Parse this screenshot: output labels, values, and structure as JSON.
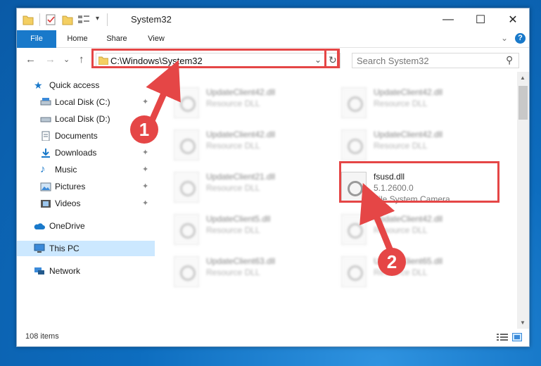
{
  "window": {
    "title": "System32",
    "qa_dropdown": "▾",
    "min": "—",
    "max": "☐",
    "close": "✕"
  },
  "ribbon": {
    "tabs": [
      "File",
      "Home",
      "Share",
      "View"
    ],
    "collapse": "⌄",
    "help": "?"
  },
  "nav": {
    "back": "←",
    "forward": "→",
    "recent": "⌄",
    "up": "↑",
    "address": "C:\\Windows\\System32",
    "address_dropdown": "⌄",
    "refresh": "↻",
    "search_placeholder": "Search System32",
    "search_icon": "⚲"
  },
  "sidebar": {
    "items": [
      {
        "label": "Quick access",
        "icon": "star-icon",
        "pinned": false
      },
      {
        "label": "Local Disk (C:)",
        "icon": "drive-icon",
        "pinned": true
      },
      {
        "label": "Local Disk (D:)",
        "icon": "drive-icon",
        "pinned": false
      },
      {
        "label": "Documents",
        "icon": "documents-icon",
        "pinned": true
      },
      {
        "label": "Downloads",
        "icon": "download-icon",
        "pinned": true
      },
      {
        "label": "Music",
        "icon": "music-icon",
        "pinned": true
      },
      {
        "label": "Pictures",
        "icon": "pictures-icon",
        "pinned": true
      },
      {
        "label": "Videos",
        "icon": "videos-icon",
        "pinned": true
      },
      {
        "label": "OneDrive",
        "icon": "cloud-icon",
        "pinned": false
      },
      {
        "label": "This PC",
        "icon": "pc-icon",
        "pinned": false
      },
      {
        "label": "Network",
        "icon": "network-icon",
        "pinned": false
      }
    ],
    "pin_glyph": "📌"
  },
  "files": {
    "col1": [
      {
        "name": "UpdateClient42.dll",
        "type": "Resource DLL"
      },
      {
        "name": "UpdateClient42.dll",
        "type": "Resource DLL"
      },
      {
        "name": "UpdateClient21.dll",
        "type": "Resource DLL"
      },
      {
        "name": "UpdateClient5.dll",
        "type": "Resource DLL"
      },
      {
        "name": "UpdateClient63.dll",
        "type": "Resource DLL"
      }
    ],
    "col2": [
      {
        "name": "UpdateClient42.dll",
        "type": "Resource DLL"
      },
      {
        "name": "UpdateClient42.dll",
        "type": "Resource DLL"
      },
      {
        "name": "UpdateClient42.dll",
        "type": "Resource DLL"
      },
      {
        "name": "UpdateClient65.dll",
        "type": "Resource DLL"
      }
    ],
    "highlight": {
      "name": "fsusd.dll",
      "version": "5.1.2600.0",
      "description": "File System Camera ..."
    }
  },
  "status": {
    "items": "108 items"
  },
  "callouts": {
    "one": "1",
    "two": "2"
  },
  "colors": {
    "accent": "#1979ca",
    "callout": "#e54646",
    "selection": "#cce8ff"
  }
}
